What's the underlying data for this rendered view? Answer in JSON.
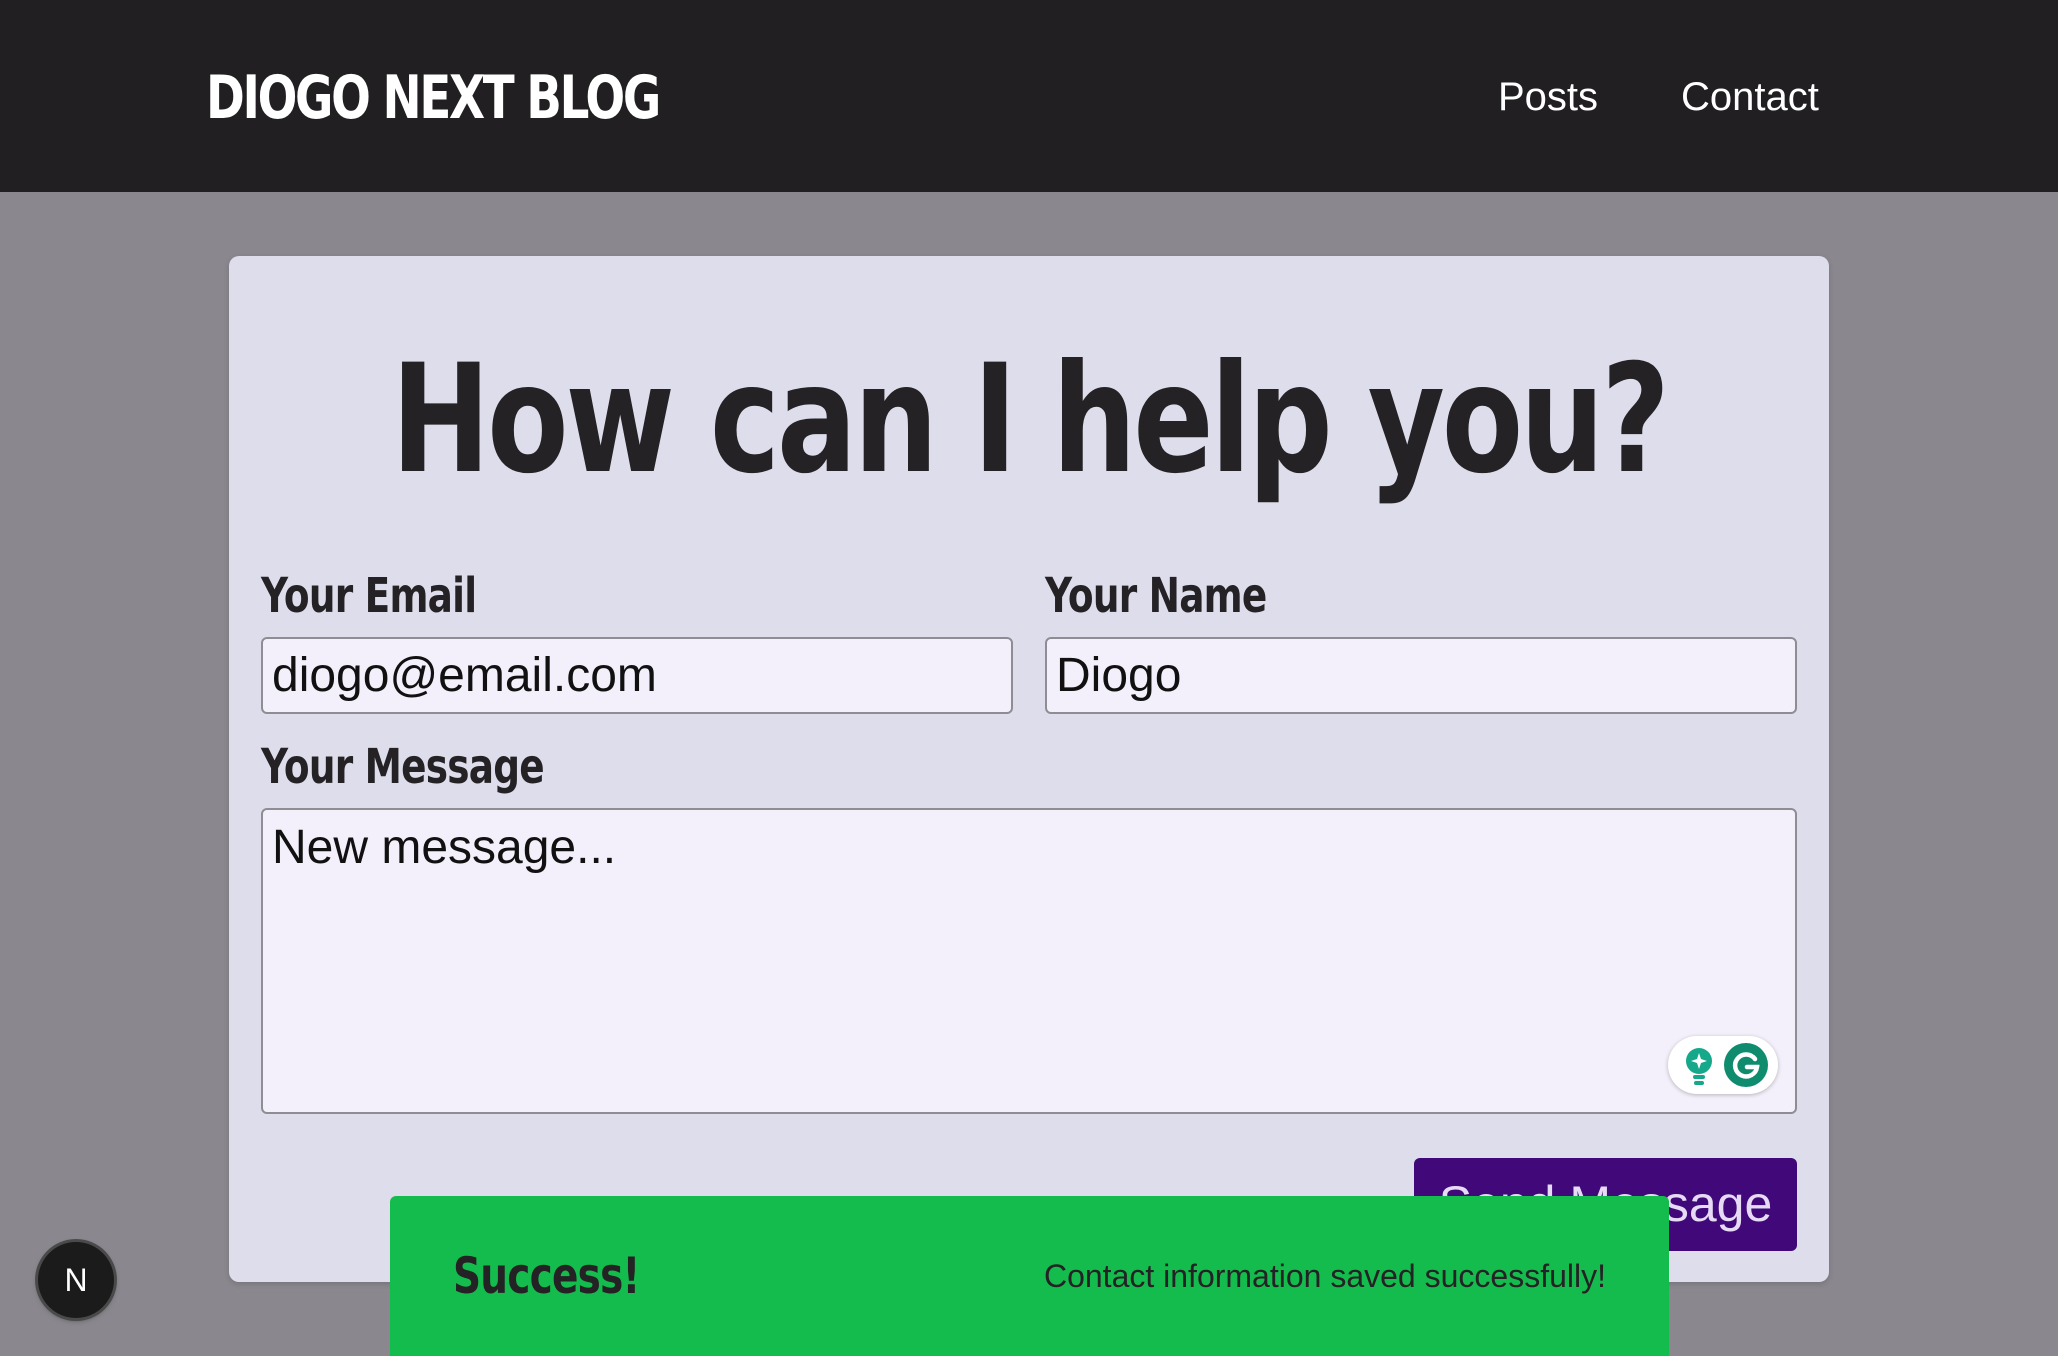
{
  "header": {
    "logo": "DIOGO NEXT BLOG",
    "nav": [
      {
        "label": "Posts"
      },
      {
        "label": "Contact"
      }
    ]
  },
  "contact_form": {
    "heading": "How can I help you?",
    "email": {
      "label": "Your Email",
      "value": "diogo@email.com"
    },
    "name": {
      "label": "Your Name",
      "value": "Diogo"
    },
    "message": {
      "label": "Your Message",
      "value": "New message..."
    },
    "submit_label": "Send Message"
  },
  "notification": {
    "title": "Success!",
    "message": "Contact information saved successfully!",
    "status_color": "#14bc4d"
  },
  "dev_badge": {
    "letter": "N"
  },
  "grammarly_widget": {
    "icons": [
      "lightbulb-icon",
      "grammarly-logo-icon"
    ]
  },
  "colors": {
    "header_bg": "#211f22",
    "page_bg": "#8a888e",
    "card_bg": "#deddeb",
    "button_bg": "#400878"
  }
}
